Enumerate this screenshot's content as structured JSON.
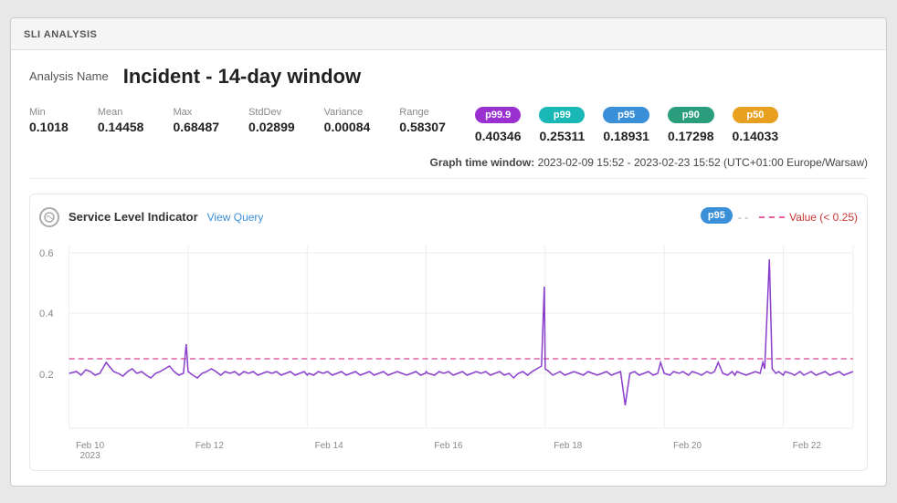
{
  "header": {
    "title": "SLI ANALYSIS"
  },
  "analysis": {
    "name_label": "Analysis Name",
    "name_value": "Incident - 14-day window"
  },
  "stats": {
    "min_label": "Min",
    "min_value": "0.1018",
    "mean_label": "Mean",
    "mean_value": "0.14458",
    "max_label": "Max",
    "max_value": "0.68487",
    "stddev_label": "StdDev",
    "stddev_value": "0.02899",
    "variance_label": "Variance",
    "variance_value": "0.00084",
    "range_label": "Range",
    "range_value": "0.58307"
  },
  "percentiles": [
    {
      "label": "p99.9",
      "value": "0.40346",
      "class": "badge-p999"
    },
    {
      "label": "p99",
      "value": "0.25311",
      "class": "badge-p99"
    },
    {
      "label": "p95",
      "value": "0.18931",
      "class": "badge-p95"
    },
    {
      "label": "p90",
      "value": "0.17298",
      "class": "badge-p90"
    },
    {
      "label": "p50",
      "value": "0.14033",
      "class": "badge-p50"
    }
  ],
  "time_window": {
    "label": "Graph time window:",
    "value": "2023-02-09 15:52 - 2023-02-23 15:52 (UTC+01:00 Europe/Warsaw)"
  },
  "chart": {
    "title": "Service Level Indicator",
    "view_query": "View Query",
    "active_percentile": "p95",
    "active_percentile_suffix": "- -",
    "value_label": "Value (< 0.25)",
    "y_labels": [
      "0.6",
      "0.4",
      "0.2"
    ],
    "x_labels": [
      {
        "line1": "Feb 10",
        "line2": "2023"
      },
      {
        "line1": "Feb 12",
        "line2": ""
      },
      {
        "line1": "Feb 14",
        "line2": ""
      },
      {
        "line1": "Feb 16",
        "line2": ""
      },
      {
        "line1": "Feb 18",
        "line2": ""
      },
      {
        "line1": "Feb 20",
        "line2": ""
      },
      {
        "line1": "Feb 22",
        "line2": ""
      }
    ]
  }
}
